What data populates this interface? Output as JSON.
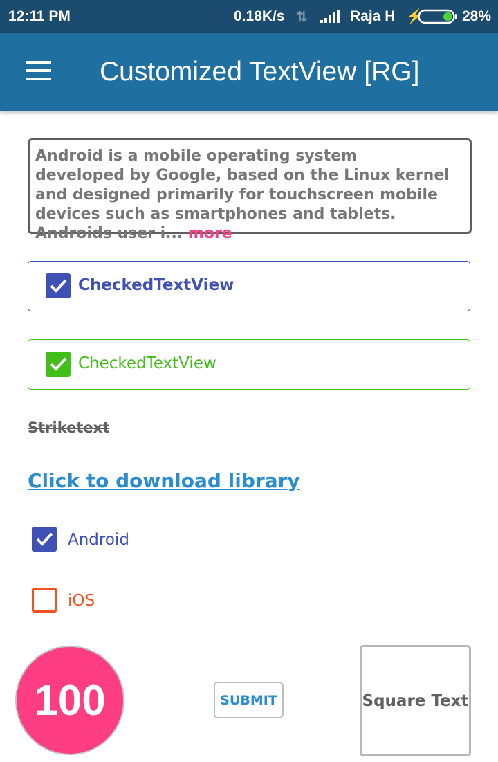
{
  "status_bar": {
    "time": "12:11 PM",
    "net_speed": "0.18K/s",
    "carrier": "Raja H",
    "battery_percent": "28%",
    "battery_level": 0.28
  },
  "app_bar": {
    "title": "Customized TextView [RG]",
    "menu_icon": "hamburger-menu-icon"
  },
  "description": {
    "text": "Android is a mobile operating system developed by Google, based on the Linux kernel and designed primarily for touchscreen mobile devices such as smartphones and tablets. Androids user i...",
    "more_label": "more"
  },
  "checked_text_views": [
    {
      "label": "CheckedTextView",
      "checked": true,
      "color": "#3f51b5"
    },
    {
      "label": "CheckedTextView",
      "checked": true,
      "color": "#41be18"
    }
  ],
  "strike_text": "Striketext",
  "download_link": "Click to download library",
  "checkboxes": [
    {
      "label": "Android",
      "checked": true,
      "color": "#3f51b5"
    },
    {
      "label": "iOS",
      "checked": false,
      "color": "#f4511e"
    }
  ],
  "circle_badge": {
    "value": "100",
    "color": "#fe3d82"
  },
  "submit_button": "SUBMIT",
  "square_text": "Square Text",
  "colors": {
    "status_bar": "#1b4b6e",
    "app_bar": "#1f6fa0",
    "link": "#2a8dcf",
    "accent": "#f33f84"
  }
}
